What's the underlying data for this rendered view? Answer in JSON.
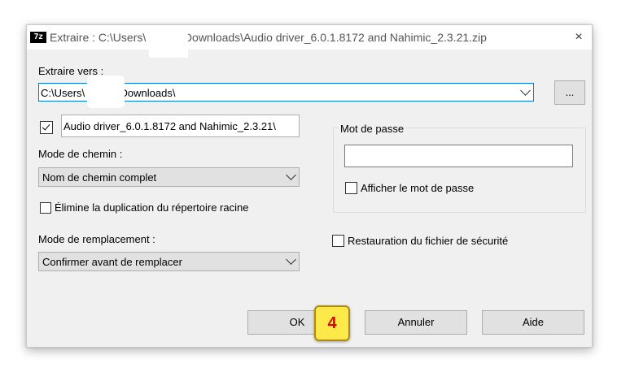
{
  "window": {
    "app_icon": "7z",
    "title": "Extraire : C:\\Users\\            Downloads\\Audio driver_6.0.1.8172 and Nahimic_2.3.21.zip",
    "close_icon": "×"
  },
  "extract_to": {
    "label": "Extraire vers :",
    "value": "C:\\Users\\            Downloads\\",
    "browse_label": "..."
  },
  "folder_name": {
    "checked": true,
    "value": "Audio driver_6.0.1.8172 and Nahimic_2.3.21\\"
  },
  "path_mode": {
    "label": "Mode de chemin :",
    "selected": "Nom de chemin complet"
  },
  "eliminate_dup": {
    "checked": false,
    "label": "Élimine la duplication du répertoire racine"
  },
  "overwrite_mode": {
    "label": "Mode de remplacement :",
    "selected": "Confirmer avant de remplacer"
  },
  "password": {
    "group_label": "Mot de passe",
    "value": "",
    "show_checked": false,
    "show_label": "Afficher le mot de passe"
  },
  "restore_security": {
    "checked": false,
    "label": "Restauration du fichier de sécurité"
  },
  "buttons": {
    "ok": "OK",
    "cancel": "Annuler",
    "help": "Aide"
  },
  "annotation": {
    "step_number": "4",
    "colors": {
      "fill": "#fde94a",
      "text": "#e00000"
    }
  },
  "colors": {
    "dialog_bg": "#f0f0f0",
    "focus_border": "#0078d7"
  }
}
